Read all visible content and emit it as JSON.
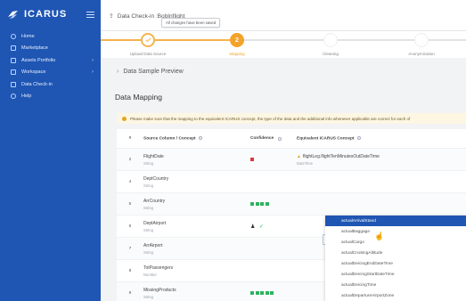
{
  "app": {
    "name": "ICARUS",
    "nav": [
      {
        "label": "Home",
        "icon": "home-icon",
        "chevron": false
      },
      {
        "label": "Marketplace",
        "icon": "store-icon",
        "chevron": false
      },
      {
        "label": "Assets Portfolio",
        "icon": "portfolio-icon",
        "chevron": true
      },
      {
        "label": "Workspace",
        "icon": "workspace-icon",
        "chevron": true
      },
      {
        "label": "Data Check-in",
        "icon": "upload-icon",
        "chevron": false
      },
      {
        "label": "Help",
        "icon": "help-icon",
        "chevron": false
      }
    ]
  },
  "header": {
    "breadcrumb": "Data Check-in :BobInflight",
    "toast": "All changes have been saved"
  },
  "stepper": {
    "steps": [
      {
        "label": "Upload Data Source",
        "state": "done"
      },
      {
        "label": "Mapping",
        "state": "active",
        "number": "2"
      },
      {
        "label": "Cleaning",
        "state": "todo"
      },
      {
        "label": "Anonymization",
        "state": "todo"
      }
    ]
  },
  "content": {
    "preview_label": "Data Sample Preview",
    "section_title": "Data Mapping",
    "notice": "Please make sure that the mapping to the equivalent ICARUS concept, the type of the data and the additional info  whenever applicable  are correct for each of",
    "columns": {
      "num": "#",
      "source": "Source Column / Concept",
      "confidence": "Confidence",
      "equivalent": "Equivalent ICARUS Concept"
    },
    "rows": [
      {
        "num": "2",
        "name": "FlightDate",
        "type": "String",
        "conf": "red",
        "eq": "flightLeg.flightTenMinutesOutDateTime",
        "eq_sub": "DateTime",
        "warn": true
      },
      {
        "num": "4",
        "name": "DeptCountry",
        "type": "String",
        "conf": "",
        "eq": "",
        "eq_sub": ""
      },
      {
        "num": "5",
        "name": "ArrCountry",
        "type": "String",
        "conf": "green4",
        "eq": "",
        "eq_sub": ""
      },
      {
        "num": "6",
        "name": "DeptAirport",
        "type": "String",
        "conf": "person",
        "eq": "",
        "eq_sub": ""
      },
      {
        "num": "7",
        "name": "ArrAirport",
        "type": "String",
        "conf": "",
        "eq": "",
        "eq_sub": ""
      },
      {
        "num": "8",
        "name": "TotPassengers",
        "type": "Number",
        "conf": "",
        "eq": "",
        "eq_sub": ""
      },
      {
        "num": "9",
        "name": "MissingProducts",
        "type": "String",
        "conf": "green5",
        "eq": "",
        "eq_sub": ""
      }
    ],
    "select_placeholder": "Select equivalent ICARUS concept",
    "dropdown": [
      "actualArrivalStand",
      "actualBaggage",
      "actualCargo",
      "actualCruisingAltitude",
      "actualDeicingEndDateTime",
      "actualDeicingStartDateTime",
      "actualDeicingTime",
      "actualDepartureAirportZone"
    ],
    "dropdown_selected": 0
  },
  "colors": {
    "sidebar": "#1f56b3",
    "accent": "#f4a32a",
    "confidence_green": "#2db360",
    "confidence_red": "#d93a3a"
  }
}
